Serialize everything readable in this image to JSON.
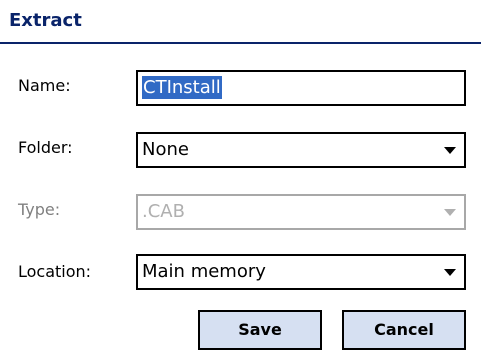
{
  "dialog": {
    "title": "Extract"
  },
  "form": {
    "name": {
      "label": "Name:",
      "value": "CTInstall"
    },
    "folder": {
      "label": "Folder:",
      "value": "None"
    },
    "type": {
      "label": "Type:",
      "value": ".CAB",
      "disabled": true
    },
    "location": {
      "label": "Location:",
      "value": "Main memory"
    }
  },
  "buttons": {
    "save_label": "Save",
    "cancel_label": "Cancel"
  },
  "colors": {
    "title": "#0a246a",
    "selection": "#316ac5",
    "button_bg": "#d6e0f2",
    "disabled_text": "#b0b0b0"
  },
  "icons": {
    "dropdown": "chevron-down-icon"
  }
}
